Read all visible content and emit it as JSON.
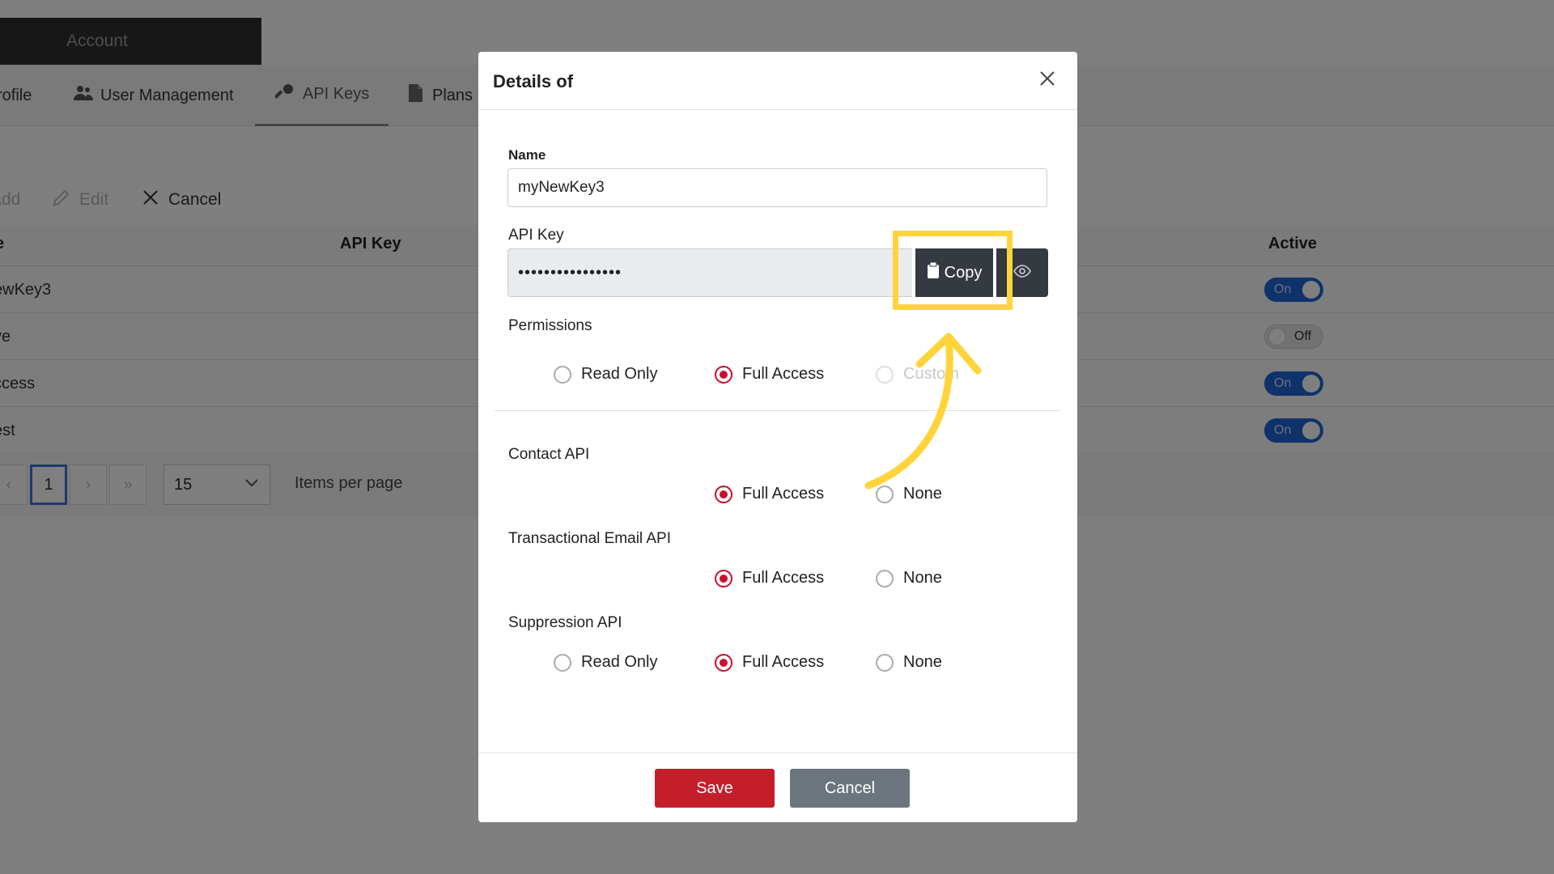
{
  "background": {
    "account_label": "Account",
    "tabs": [
      {
        "label": "rofile",
        "icon": "user-icon"
      },
      {
        "label": "User Management",
        "icon": "users-icon"
      },
      {
        "label": "API Keys",
        "icon": "key-icon"
      },
      {
        "label": "Plans",
        "icon": "document-icon"
      }
    ],
    "toolbar": {
      "add": "Add",
      "edit": "Edit",
      "cancel": "Cancel"
    },
    "table": {
      "headers": {
        "name": "e",
        "api_key": "API Key",
        "active": "Active"
      },
      "rows": [
        {
          "name": "ewKey3",
          "active": "On"
        },
        {
          "name": "ve",
          "active": "Off"
        },
        {
          "name": "ccess",
          "active": "On"
        },
        {
          "name": "est",
          "active": "On"
        }
      ]
    },
    "pager": {
      "current_page": "1",
      "prev": "‹",
      "next": "›",
      "last": "»",
      "first": "‹",
      "per_page": "15",
      "per_page_label": "Items per page"
    }
  },
  "modal": {
    "title": "Details of",
    "name_label": "Name",
    "name_value": "myNewKey3",
    "api_key_label": "API Key",
    "api_key_value": "••••••••••••••••",
    "copy_label": "Copy",
    "permissions_label": "Permissions",
    "permissions_options": {
      "read_only": "Read Only",
      "full_access": "Full Access",
      "custom": "Custom"
    },
    "sections": [
      {
        "label": "Contact API",
        "full_access": "Full Access",
        "none": "None"
      },
      {
        "label": "Transactional Email API",
        "full_access": "Full Access",
        "none": "None"
      },
      {
        "label": "Suppression API",
        "read_only": "Read Only",
        "full_access": "Full Access",
        "none": "None"
      }
    ],
    "save_label": "Save",
    "cancel_label": "Cancel"
  },
  "colors": {
    "accent": "#c41e2a",
    "highlight": "#ffd43b",
    "toggle_on": "#1e64d6"
  }
}
